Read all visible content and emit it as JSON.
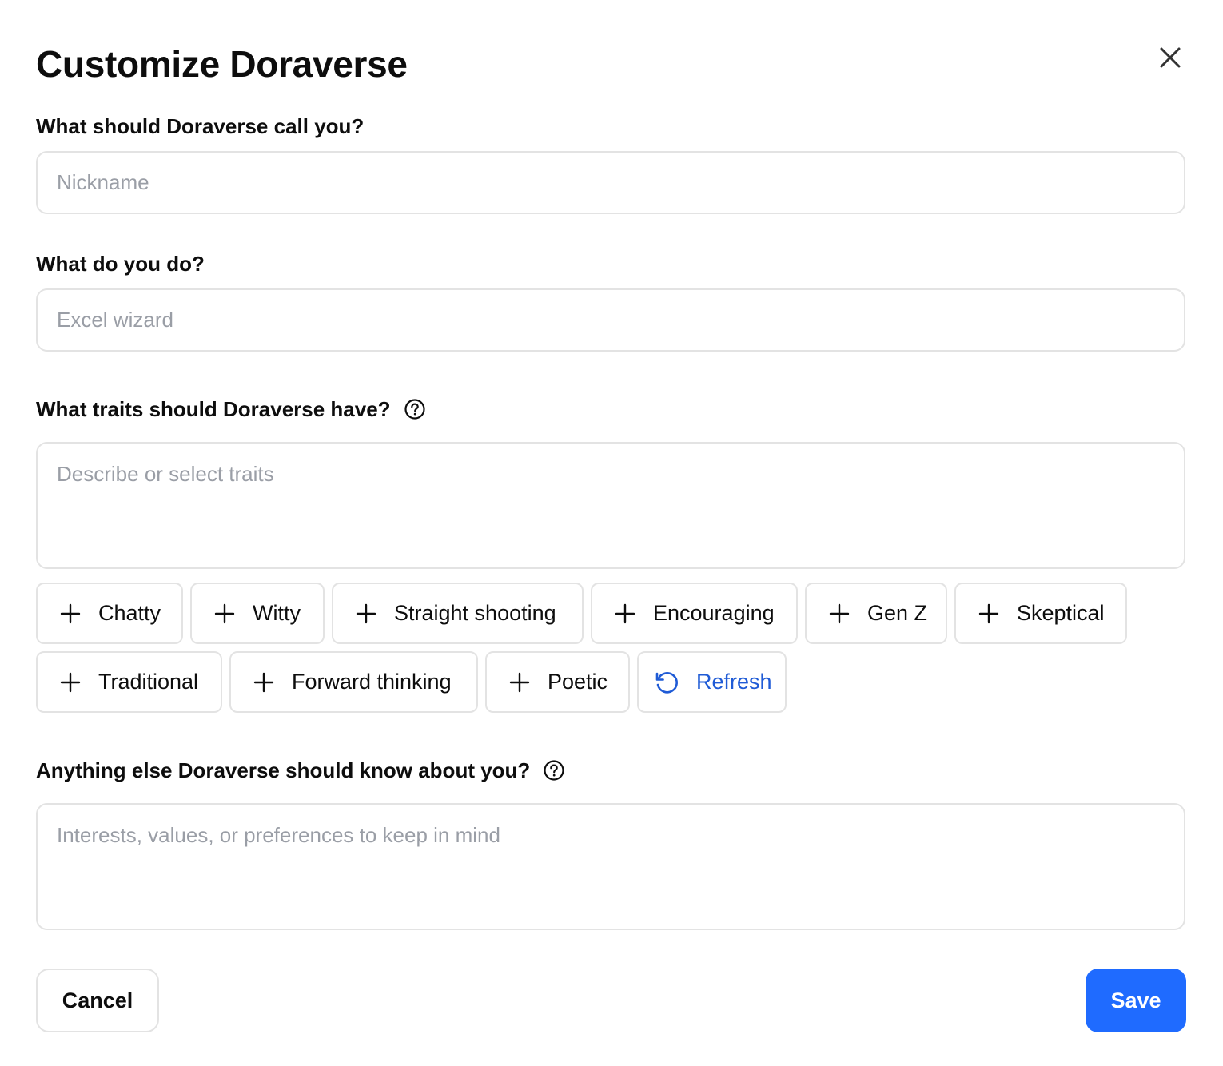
{
  "dialog": {
    "title": "Customize Doraverse",
    "close_icon": "close-icon"
  },
  "nickname": {
    "label": "What should Doraverse call you?",
    "placeholder": "Nickname",
    "value": ""
  },
  "occupation": {
    "label": "What do you do?",
    "placeholder": "Excel wizard",
    "value": ""
  },
  "traits": {
    "label": "What traits should Doraverse have?",
    "help_icon": "question-circle-icon",
    "placeholder": "Describe or select traits",
    "value": "",
    "chips": [
      "Chatty",
      "Witty",
      "Straight shooting",
      "Encouraging",
      "Gen Z",
      "Skeptical",
      "Traditional",
      "Forward thinking",
      "Poetic"
    ],
    "chip_icon": "plus-icon",
    "refresh_label": "Refresh",
    "refresh_icon": "refresh-icon",
    "refresh_color": "#1f5bd6"
  },
  "about": {
    "label": "Anything else Doraverse should know about you?",
    "help_icon": "question-circle-icon",
    "placeholder": "Interests, values, or preferences to keep in mind",
    "value": ""
  },
  "actions": {
    "cancel_label": "Cancel",
    "save_label": "Save",
    "save_color": "#1f6bff"
  }
}
